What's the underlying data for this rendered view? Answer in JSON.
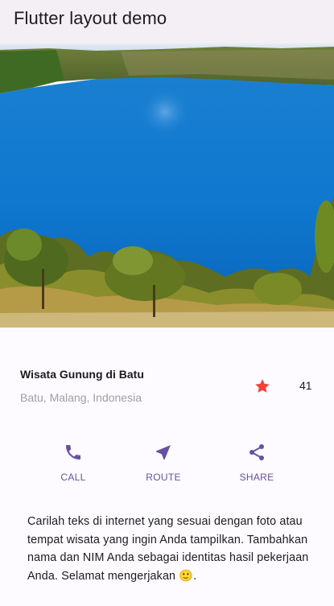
{
  "app_bar": {
    "title": "Flutter layout demo"
  },
  "title_section": {
    "name": "Wisata Gunung di Batu",
    "location": "Batu, Malang, Indonesia",
    "star_count": "41",
    "star_icon": "star-icon",
    "star_color": "#f44336"
  },
  "buttons": [
    {
      "label": "CALL",
      "icon": "phone-icon"
    },
    {
      "label": "ROUTE",
      "icon": "near-me-icon"
    },
    {
      "label": "SHARE",
      "icon": "share-icon"
    }
  ],
  "colors": {
    "accent": "#6750a4",
    "app_bar_bg": "#f4eff4",
    "location_text": "#9e9e9e"
  },
  "description": "Carilah teks di internet yang sesuai dengan foto atau tempat wisata yang ingin Anda tampilkan. Tambahkan nama dan NIM Anda sebagai identitas hasil pekerjaan Anda. Selamat mengerjakan 🙂."
}
